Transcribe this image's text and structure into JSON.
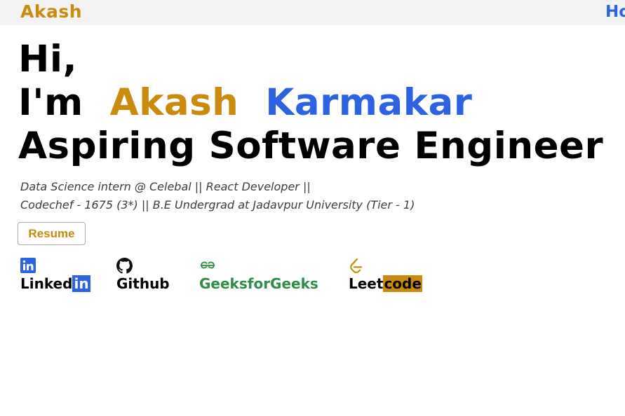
{
  "navbar": {
    "brand": "Akash",
    "link": "Ho"
  },
  "hero": {
    "greeting": "Hi,",
    "im": "I'm",
    "first_name": "Akash",
    "last_name": "Karmakar",
    "role": "Aspiring Software Engineer"
  },
  "description": {
    "line1": "Data Science intern @ Celebal || React Developer ||",
    "line2": "Codechef - 1675 (3*) || B.E Undergrad at Jadavpur University (Tier - 1)"
  },
  "resume_label": "Resume",
  "socials": {
    "linkedin": {
      "text": "Linked",
      "box": "in",
      "icon": "linkedin-icon"
    },
    "github": {
      "text": "Github",
      "icon": "github-icon"
    },
    "gfg": {
      "text": "GeeksforGeeks",
      "icon": "geeksforgeeks-icon",
      "color": "#2f8d46"
    },
    "leetcode": {
      "text": "Leet",
      "box": "code",
      "icon": "leetcode-icon"
    }
  },
  "colors": {
    "accent_gold": "#c98a0d",
    "accent_blue": "#2b63e3"
  }
}
